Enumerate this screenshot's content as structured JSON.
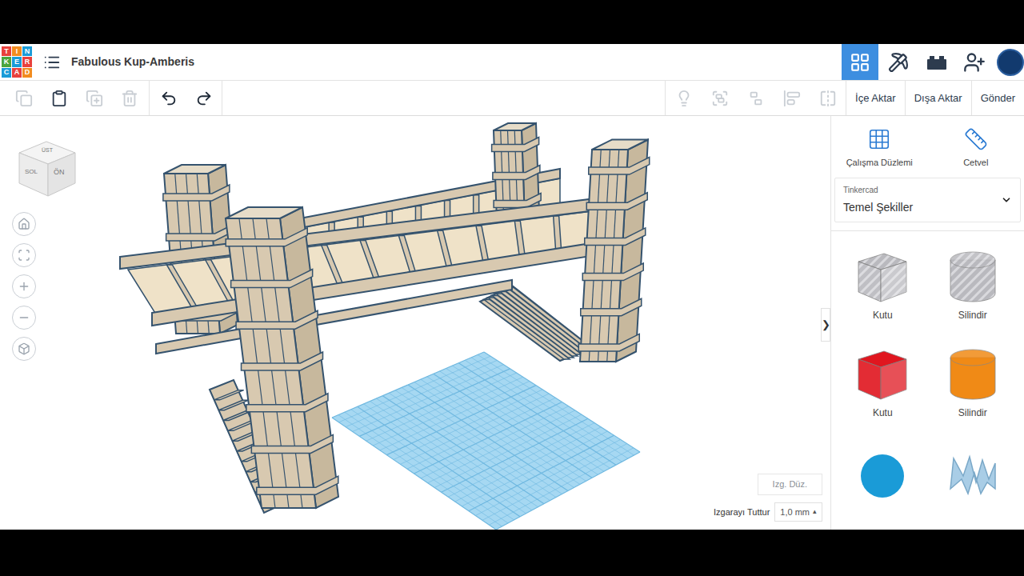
{
  "header": {
    "logo": [
      "TIN",
      "KER",
      "CAD"
    ],
    "title": "Fabulous Kup-Amberis"
  },
  "view_modes": [
    {
      "selected": true
    },
    {
      "selected": false
    },
    {
      "selected": false
    }
  ],
  "toolbar": {
    "edit_tools": [
      {
        "disabled": true
      },
      {
        "disabled": false
      },
      {
        "disabled": true
      },
      {
        "disabled": true
      },
      {
        "disabled": false
      },
      {
        "disabled": false
      }
    ],
    "shape_tools": [
      {
        "disabled": true
      },
      {
        "disabled": true
      },
      {
        "disabled": true
      },
      {
        "disabled": true
      },
      {
        "disabled": true
      }
    ],
    "actions": [
      "İçe Aktar",
      "Dışa Aktar",
      "Gönder"
    ]
  },
  "view_cube": {
    "top": "ÜST",
    "left": "SOL",
    "front": "ÖN"
  },
  "grid": {
    "edit_button": "Izg. Düz.",
    "snap_label": "Izgarayı Tuttur",
    "snap_value": "1,0 mm",
    "snap_arrow": "▴"
  },
  "panel": {
    "collapse": "❯",
    "tools": [
      "Çalışma Düzlemi",
      "Cetvel"
    ],
    "library": {
      "source": "Tinkercad",
      "category": "Temel Şekiller"
    },
    "shapes": [
      {
        "label": "Kutu",
        "kind": "box",
        "hole": true,
        "color": "#b9b9be"
      },
      {
        "label": "Silindir",
        "kind": "cylinder",
        "hole": true,
        "color": "#b9b9be"
      },
      {
        "label": "Kutu",
        "kind": "box",
        "hole": false,
        "color": "#e0161f"
      },
      {
        "label": "Silindir",
        "kind": "cylinder",
        "hole": false,
        "color": "#f08a16"
      },
      {
        "kind": "sphere",
        "hole": false,
        "color": "#1a9bd7"
      },
      {
        "kind": "text",
        "hole": false,
        "color": "#a9cde6"
      }
    ]
  }
}
